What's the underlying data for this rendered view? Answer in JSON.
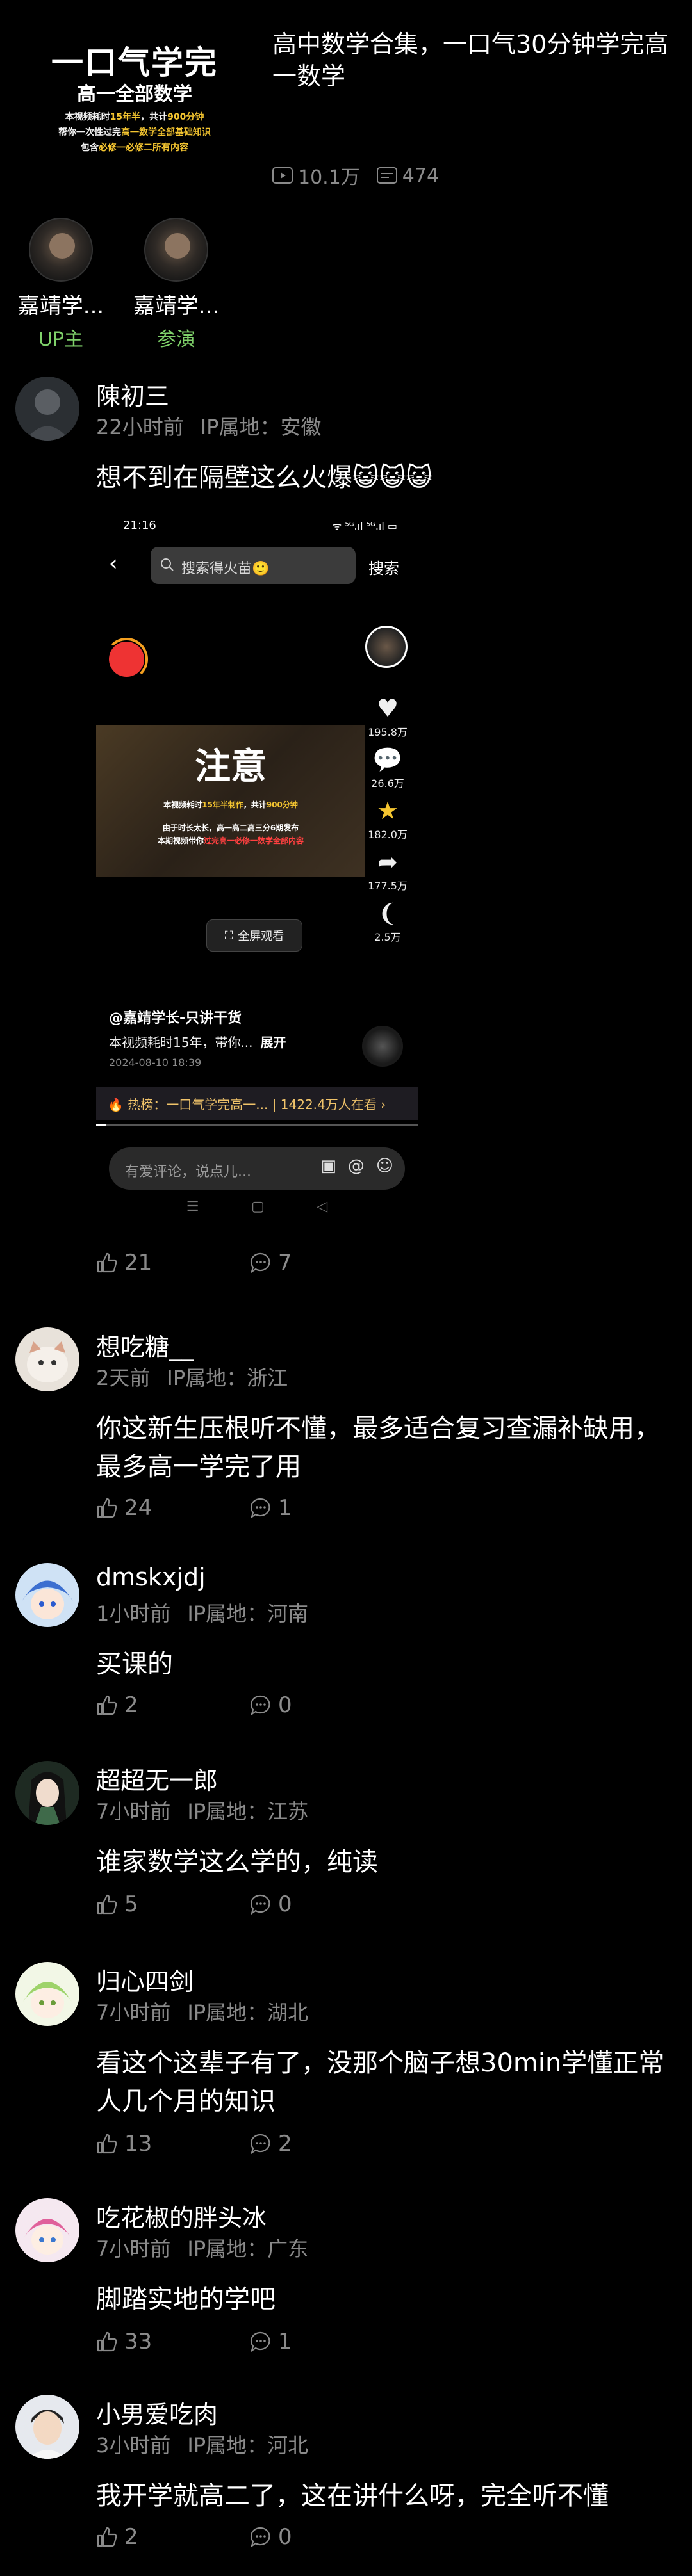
{
  "video": {
    "thumbnail": {
      "title": "一口气学完",
      "subtitle": "高一全部数学",
      "line1_a": "本视频耗时",
      "line1_b": "15年半",
      "line1_c": "，共计",
      "line1_d": "900分钟",
      "line2_a": "帮你一次性过完",
      "line2_b": "高一数学全部基础知识",
      "line3_a": "包含",
      "line3_b": "必修一必修二所有内容"
    },
    "title": "高中数学合集，一口气30分钟学完高一数学",
    "plays": "10.1万",
    "danmaku": "474"
  },
  "creators": [
    {
      "name": "嘉靖学...",
      "role": "UP主"
    },
    {
      "name": "嘉靖学...",
      "role": "参演"
    }
  ],
  "comments": [
    {
      "user": "陳初三",
      "time": "22小时前",
      "ip": "IP属地：安徽",
      "text": "想不到在隔壁这么火爆😺😺😺",
      "likes": "21",
      "replies": "7"
    },
    {
      "user": "想吃糖__",
      "time": "2天前",
      "ip": "IP属地：浙江",
      "text": "你这新生压根听不懂，最多适合复习查漏补缺用，最多高一学完了用",
      "likes": "24",
      "replies": "1"
    },
    {
      "user": "dmskxjdj",
      "time": "1小时前",
      "ip": "IP属地：河南",
      "text": "买课的",
      "likes": "2",
      "replies": "0"
    },
    {
      "user": "超超无一郎",
      "time": "7小时前",
      "ip": "IP属地：江苏",
      "text": "谁家数学这么学的，纯读",
      "likes": "5",
      "replies": "0"
    },
    {
      "user": "归心四剑",
      "time": "7小时前",
      "ip": "IP属地：湖北",
      "text": "看这个这辈子有了，没那个脑子想30min学懂正常人几个月的知识",
      "likes": "13",
      "replies": "2"
    },
    {
      "user": "吃花椒的胖头冰",
      "time": "7小时前",
      "ip": "IP属地：广东",
      "text": "脚踏实地的学吧",
      "likes": "33",
      "replies": "1"
    },
    {
      "user": "小男爱吃肉",
      "time": "3小时前",
      "ip": "IP属地：河北",
      "text": "我开学就高二了，这在讲什么呀，完全听不懂",
      "likes": "2",
      "replies": "0"
    }
  ],
  "embedded": {
    "time": "21:16",
    "status_right": "ᯤ ⁵ᴳ.ıl ⁵ᴳ.ıl ▭",
    "search_placeholder": "搜索得火苗🙂",
    "search_button": "搜索",
    "notice": "注意",
    "notice_line1_a": "本视频耗时",
    "notice_line1_b": "15年半制作",
    "notice_line1_c": "，共计",
    "notice_line1_d": "900分钟",
    "notice_line2": "由于时长太长，高一高二高三分6期发布",
    "notice_line3_a": "本期视频带你",
    "notice_line3_b": "过完高一必修一数学全部内容",
    "fullscreen": "全屏观看",
    "like_count": "195.8万",
    "comment_count": "26.6万",
    "fav_count": "182.0万",
    "share_count": "177.5万",
    "recommend_count": "2.5万",
    "handle": "@嘉靖学长-只讲干货",
    "desc": "本视频耗时15年，带你...",
    "desc_more": "展开",
    "date": "2024-08-10 18:39",
    "hot": "🔥 热榜：一口气学完高一...   | 1422.4万人在看   ›",
    "progress": 0.03,
    "input_placeholder": "有爱评论，说点儿...",
    "nav": [
      "☰",
      "▢",
      "◁"
    ]
  }
}
